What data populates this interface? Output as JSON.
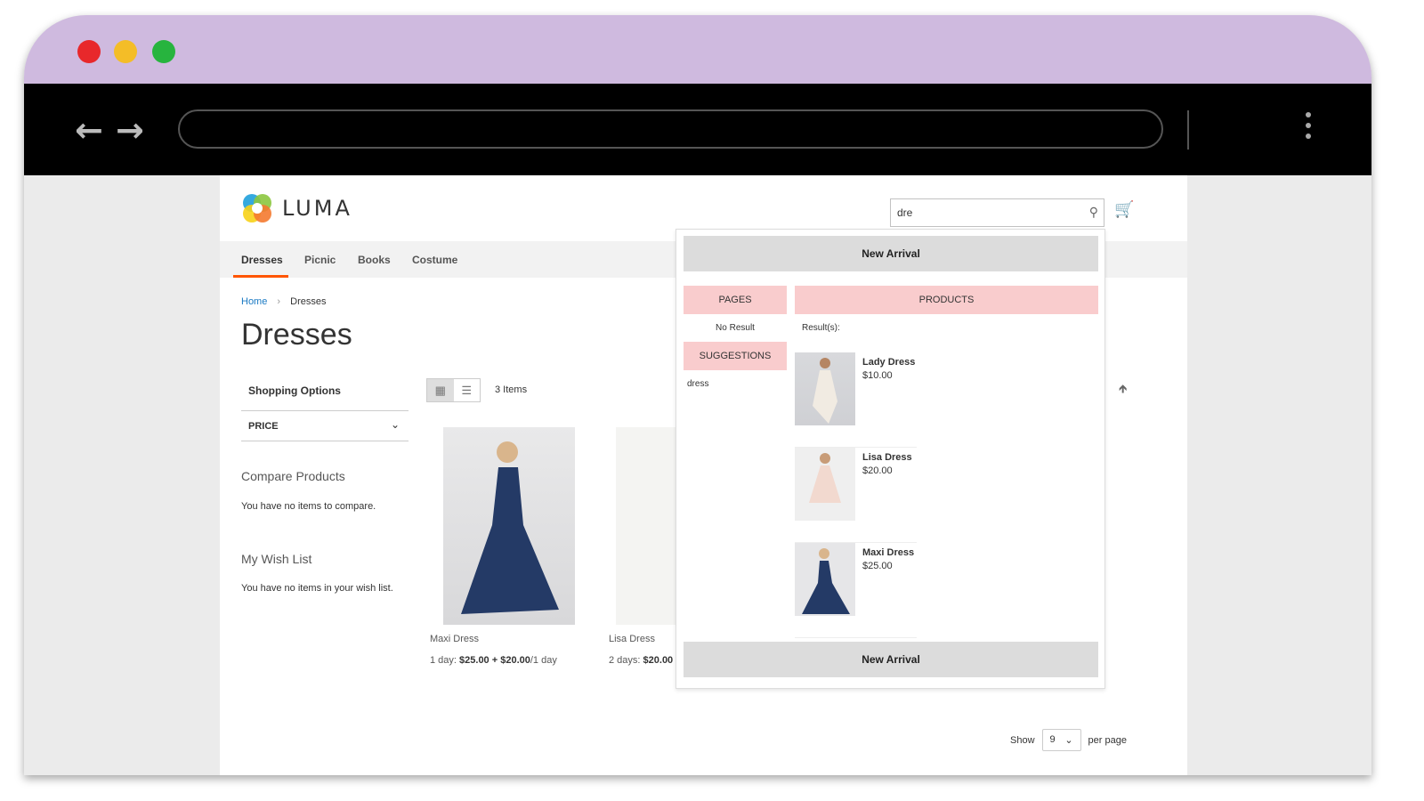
{
  "browser": {
    "window_controls": {
      "close": "#e8282b",
      "minimize": "#f4bd27",
      "maximize": "#27b43e"
    },
    "back_icon": "arrow-left",
    "forward_icon": "arrow-right",
    "menu_icon": "kebab",
    "address": ""
  },
  "store": {
    "logo_text": "LUMA",
    "search": {
      "value": "dre",
      "icon": "search-icon"
    },
    "cart_icon": "cart-icon",
    "nav": [
      {
        "label": "Dresses",
        "active": true
      },
      {
        "label": "Picnic"
      },
      {
        "label": "Books"
      },
      {
        "label": "Costume"
      }
    ],
    "nav_accent": "#ff5501",
    "breadcrumb": {
      "home": "Home",
      "separator": "›",
      "current": "Dresses"
    },
    "page_title": "Dresses",
    "sidebar": {
      "shopping_options": "Shopping Options",
      "price_filter": "PRICE",
      "compare_title": "Compare Products",
      "compare_text": "You have no items to compare.",
      "wishlist_title": "My Wish List",
      "wishlist_text": "You have no items in your wish list."
    },
    "toolbar": {
      "items_count": "3 Items",
      "grid_icon": "grid-icon",
      "list_icon": "list-icon",
      "show_label": "Show",
      "per_page_value": "9",
      "per_page_label": "per page"
    },
    "products": [
      {
        "name": "Maxi Dress",
        "price_prefix": "1 day: ",
        "price_bold": "$25.00 + $20.00",
        "price_suffix": "/1 day"
      },
      {
        "name": "Lisa Dress",
        "price_prefix": "2 days: ",
        "price_bold": "$20.00",
        "price_suffix": ""
      }
    ]
  },
  "autocomplete": {
    "banner_top": "New Arrival",
    "banner_bottom": "New Arrival",
    "pages_header": "PAGES",
    "pages_result": "No Result",
    "suggestions_header": "SUGGESTIONS",
    "suggestions": [
      "dress"
    ],
    "products_header": "PRODUCTS",
    "results_label": "Result(s):",
    "products": [
      {
        "name": "Lady Dress",
        "price": "$10.00"
      },
      {
        "name": "Lisa Dress",
        "price": "$20.00"
      },
      {
        "name": "Maxi Dress",
        "price": "$25.00"
      }
    ],
    "header_color": "#f9cccd"
  }
}
